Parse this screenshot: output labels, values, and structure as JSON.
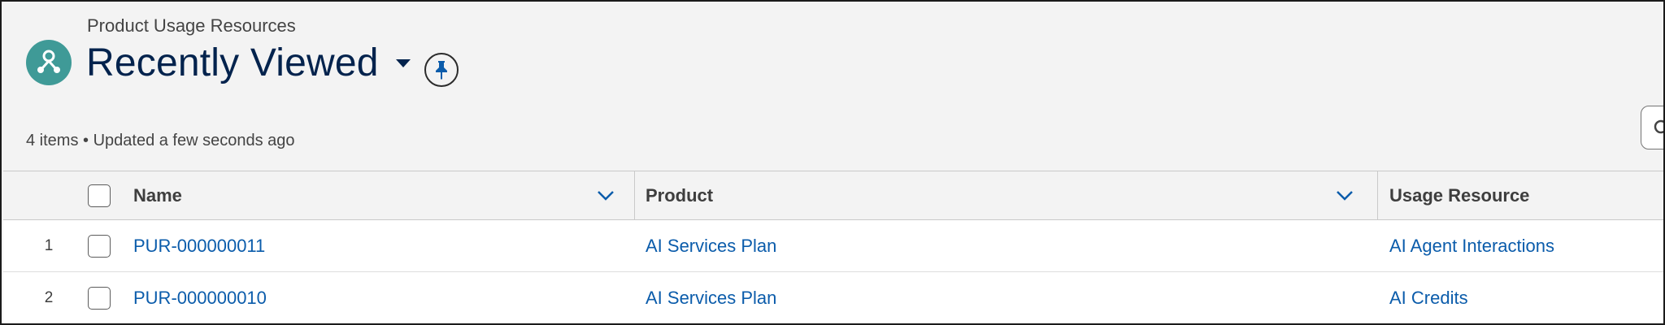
{
  "header": {
    "object_label": "Product Usage Resources",
    "list_title": "Recently Viewed",
    "status": "4 items • Updated a few seconds ago",
    "icons": {
      "object": "product-usage-resource-icon",
      "list_view_menu": "caret-down-icon",
      "pin": "pin-icon",
      "search": "search-icon"
    }
  },
  "table": {
    "columns": [
      {
        "label": "Name"
      },
      {
        "label": "Product"
      },
      {
        "label": "Usage Resource"
      }
    ],
    "rows": [
      {
        "num": "1",
        "name": "PUR-000000011",
        "product": "AI Services Plan",
        "usage_resource": "AI Agent Interactions"
      },
      {
        "num": "2",
        "name": "PUR-000000010",
        "product": "AI Services Plan",
        "usage_resource": "AI Credits"
      }
    ]
  },
  "colors": {
    "object_icon_bg": "#3f9a97",
    "title": "#03234d",
    "link": "#0b5cab",
    "chevron": "#0b5cab"
  }
}
